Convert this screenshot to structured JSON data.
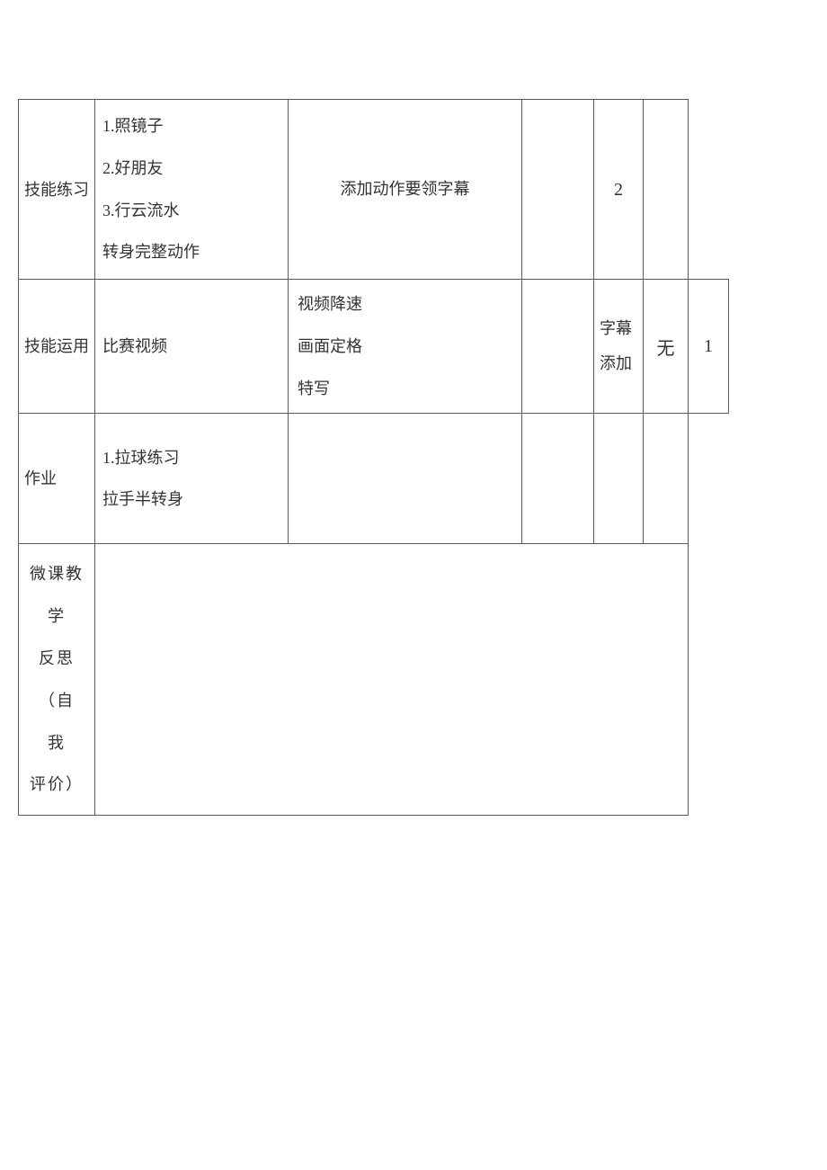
{
  "rows": {
    "skill_practice": {
      "label": "技能练习",
      "items_1": "1.照镜子",
      "items_2": "2.好朋友",
      "items_3": "3.行云流水",
      "items_4": "转身完整动作",
      "c3": "添加动作要领字幕",
      "c5": "2"
    },
    "skill_apply": {
      "label": "技能运用",
      "c2": "比赛视频",
      "c3_1": "视频降速",
      "c3_2": "画面定格",
      "c3_3": "特写",
      "c5_1": "字幕",
      "c5_2": "添加",
      "c6": "无",
      "c7": "1"
    },
    "homework": {
      "label": "作业",
      "c2_1": "1.拉球练习",
      "c2_2": "拉手半转身"
    },
    "reflection": {
      "l1": "微课教学",
      "l2": "反思（自",
      "l3": "我",
      "l4": "评价）"
    }
  }
}
